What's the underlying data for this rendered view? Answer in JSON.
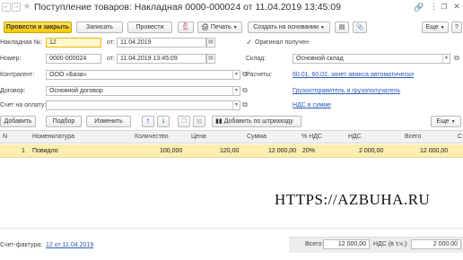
{
  "window": {
    "title": "Поступление товаров: Накладная 0000-000024 от 11.04.2019 13:45:09",
    "icons": [
      "arrow-left-icon",
      "arrow-right-icon",
      "star-icon",
      "link-icon",
      "more-icon",
      "close-icon"
    ]
  },
  "toolbar": {
    "post_close": "Провести и закрыть",
    "save": "Записать",
    "post": "Провести",
    "print": "Печать",
    "create_basis": "Создать на основании",
    "more": "Еще",
    "help": "?"
  },
  "form": {
    "invoice_no_label": "Накладная №:",
    "invoice_no_value": "12",
    "from1_label": "от:",
    "date1": "11.04.2019",
    "original_label": "Оригинал получен",
    "original_checked": true,
    "number_label": "Номер:",
    "number_value": "0000-000024",
    "from2_label": "от:",
    "date2": "11.04.2019 13:45:09",
    "warehouse_label": "Склад:",
    "warehouse_value": "Основной склад",
    "contractor_label": "Контрагент:",
    "contractor_value": "ООО «База»",
    "settlements_label": "Расчеты:",
    "settlements_link": "60.01, 60.02, зачет аванса автоматически",
    "contract_label": "Договор:",
    "contract_value": "Основной договор",
    "shipper_link": "Грузоотправитель и грузополучатель",
    "payment_label": "Счет на оплату:",
    "payment_value": "",
    "vat_link": "НДС в сумме"
  },
  "table_toolbar": {
    "add": "Добавить",
    "pick": "Подбор",
    "change": "Изменить",
    "barcode": "Добавить по штрихкоду",
    "more": "Еще"
  },
  "table": {
    "headers": [
      "N",
      "Номенклатура",
      "Количество",
      "Цена",
      "Сумма",
      "% НДС",
      "НДС",
      "Всего",
      "С"
    ],
    "rows": [
      [
        "1",
        "Повидло",
        "100,000",
        "120,00",
        "12 000,00",
        "20%",
        "2 000,00",
        "12 000,00",
        ""
      ]
    ]
  },
  "watermark": "HTTPS://AZBUHA.RU",
  "footer": {
    "invoice_label": "Счет-фактура:",
    "invoice_link": "12 от 11.04.2019",
    "total_label": "Всего:",
    "total_value": "12 000,00",
    "vat_label": "НДС (в т.ч.):",
    "vat_value": "2 000,00"
  },
  "colors": {
    "accent": "#f5c900",
    "selected_row": "#fbeeb0",
    "link": "#2d5bb5",
    "checkbox": "#2e8b2e"
  }
}
